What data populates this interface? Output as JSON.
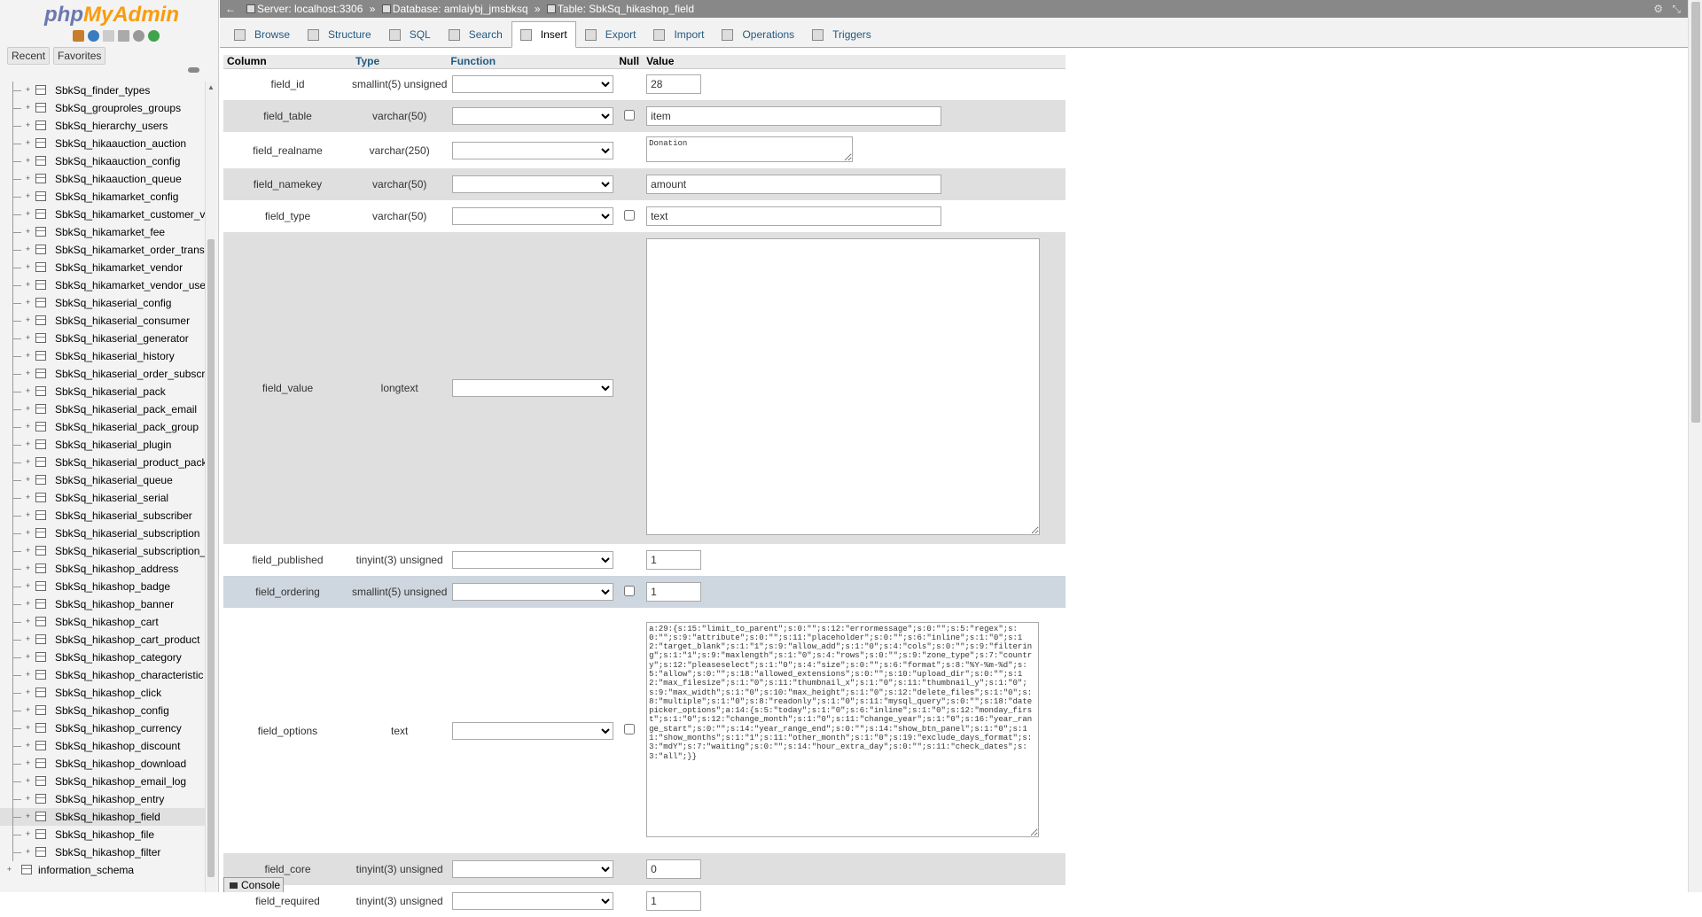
{
  "app": {
    "logo_php": "php",
    "logo_myadmin": "MyAdmin"
  },
  "nav": {
    "recent_label": "Recent",
    "favorites_label": "Favorites",
    "tables": [
      "SbkSq_finder_types",
      "SbkSq_grouproles_groups",
      "SbkSq_hierarchy_users",
      "SbkSq_hikaauction_auction",
      "SbkSq_hikaauction_config",
      "SbkSq_hikaauction_queue",
      "SbkSq_hikamarket_config",
      "SbkSq_hikamarket_customer_v",
      "SbkSq_hikamarket_fee",
      "SbkSq_hikamarket_order_transa",
      "SbkSq_hikamarket_vendor",
      "SbkSq_hikamarket_vendor_use",
      "SbkSq_hikaserial_config",
      "SbkSq_hikaserial_consumer",
      "SbkSq_hikaserial_generator",
      "SbkSq_hikaserial_history",
      "SbkSq_hikaserial_order_subscr",
      "SbkSq_hikaserial_pack",
      "SbkSq_hikaserial_pack_email",
      "SbkSq_hikaserial_pack_group",
      "SbkSq_hikaserial_plugin",
      "SbkSq_hikaserial_product_pack",
      "SbkSq_hikaserial_queue",
      "SbkSq_hikaserial_serial",
      "SbkSq_hikaserial_subscriber",
      "SbkSq_hikaserial_subscription",
      "SbkSq_hikaserial_subscription_",
      "SbkSq_hikashop_address",
      "SbkSq_hikashop_badge",
      "SbkSq_hikashop_banner",
      "SbkSq_hikashop_cart",
      "SbkSq_hikashop_cart_product",
      "SbkSq_hikashop_category",
      "SbkSq_hikashop_characteristic",
      "SbkSq_hikashop_click",
      "SbkSq_hikashop_config",
      "SbkSq_hikashop_currency",
      "SbkSq_hikashop_discount",
      "SbkSq_hikashop_download",
      "SbkSq_hikashop_email_log",
      "SbkSq_hikashop_entry",
      "SbkSq_hikashop_field",
      "SbkSq_hikashop_file",
      "SbkSq_hikashop_filter"
    ],
    "active_table": "SbkSq_hikashop_field",
    "extra_db": "information_schema"
  },
  "breadcrumb": {
    "server": "Server: localhost:3306",
    "database": "Database: amlaiybj_jmsbksq",
    "table": "Table: SbkSq_hikashop_field",
    "sep": "»"
  },
  "tabs": [
    {
      "label": "Browse",
      "icon": "browse-icon"
    },
    {
      "label": "Structure",
      "icon": "structure-icon"
    },
    {
      "label": "SQL",
      "icon": "sql-icon"
    },
    {
      "label": "Search",
      "icon": "search-icon"
    },
    {
      "label": "Insert",
      "icon": "insert-icon",
      "active": true
    },
    {
      "label": "Export",
      "icon": "export-icon"
    },
    {
      "label": "Import",
      "icon": "import-icon"
    },
    {
      "label": "Operations",
      "icon": "operations-icon"
    },
    {
      "label": "Triggers",
      "icon": "triggers-icon"
    }
  ],
  "form": {
    "headers": {
      "column": "Column",
      "type": "Type",
      "function": "Function",
      "null": "Null",
      "value": "Value"
    },
    "rows": [
      {
        "name": "field_id",
        "type": "smallint(5) unsigned",
        "null": false,
        "value": "28"
      },
      {
        "name": "field_table",
        "type": "varchar(50)",
        "null": true,
        "value": "item"
      },
      {
        "name": "field_realname",
        "type": "varchar(250)",
        "null": false,
        "value": "Donation"
      },
      {
        "name": "field_namekey",
        "type": "varchar(50)",
        "null": false,
        "value": "amount"
      },
      {
        "name": "field_type",
        "type": "varchar(50)",
        "null": true,
        "value": "text"
      },
      {
        "name": "field_value",
        "type": "longtext",
        "null": false,
        "value": ""
      },
      {
        "name": "field_published",
        "type": "tinyint(3) unsigned",
        "null": false,
        "value": "1"
      },
      {
        "name": "field_ordering",
        "type": "smallint(5) unsigned",
        "null": true,
        "value": "1"
      },
      {
        "name": "field_options",
        "type": "text",
        "null": true,
        "value": "a:29:{s:15:\"limit_to_parent\";s:0:\"\";s:12:\"errormessage\";s:0:\"\";s:5:\"regex\";s:0:\"\";s:9:\"attribute\";s:0:\"\";s:11:\"placeholder\";s:0:\"\";s:6:\"inline\";s:1:\"0\";s:12:\"target_blank\";s:1:\"1\";s:9:\"allow_add\";s:1:\"0\";s:4:\"cols\";s:0:\"\";s:9:\"filtering\";s:1:\"1\";s:9:\"maxlength\";s:1:\"0\";s:4:\"rows\";s:0:\"\";s:9:\"zone_type\";s:7:\"country\";s:12:\"pleaseselect\";s:1:\"0\";s:4:\"size\";s:0:\"\";s:6:\"format\";s:8:\"%Y-%m-%d\";s:5:\"allow\";s:0:\"\";s:18:\"allowed_extensions\";s:0:\"\";s:10:\"upload_dir\";s:0:\"\";s:12:\"max_filesize\";s:1:\"0\";s:11:\"thumbnail_x\";s:1:\"0\";s:11:\"thumbnail_y\";s:1:\"0\";s:9:\"max_width\";s:1:\"0\";s:10:\"max_height\";s:1:\"0\";s:12:\"delete_files\";s:1:\"0\";s:8:\"multiple\";s:1:\"0\";s:8:\"readonly\";s:1:\"0\";s:11:\"mysql_query\";s:0:\"\";s:18:\"datepicker_options\";a:14:{s:5:\"today\";s:1:\"0\";s:6:\"inline\";s:1:\"0\";s:12:\"monday_first\";s:1:\"0\";s:12:\"change_month\";s:1:\"0\";s:11:\"change_year\";s:1:\"0\";s:16:\"year_range_start\";s:0:\"\";s:14:\"year_range_end\";s:0:\"\";s:14:\"show_btn_panel\";s:1:\"0\";s:11:\"show_months\";s:1:\"1\";s:11:\"other_month\";s:1:\"0\";s:19:\"exclude_days_format\";s:3:\"mdY\";s:7:\"waiting\";s:0:\"\";s:14:\"hour_extra_day\";s:0:\"\";s:11:\"check_dates\";s:3:\"all\";}}"
      },
      {
        "name": "field_core",
        "type": "tinyint(3) unsigned",
        "null": false,
        "value": "0"
      },
      {
        "name": "field_required",
        "type": "tinyint(3) unsigned",
        "null": false,
        "value": "1"
      }
    ]
  },
  "console": {
    "label": "Console"
  },
  "colors": {
    "accent": "#235a81",
    "logo_php": "#6c78af",
    "logo_myadmin": "#f89c0e",
    "marked_row": "#ced6df"
  }
}
